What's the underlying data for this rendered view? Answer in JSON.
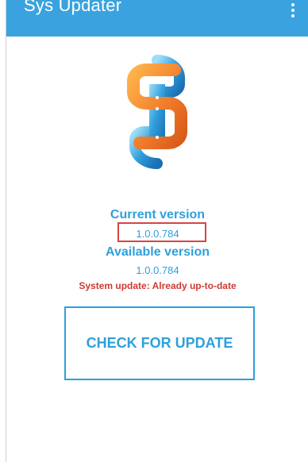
{
  "appbar": {
    "title": "Sys Updater",
    "color": "#3aa3df",
    "menu_icon": "more-vert-icon"
  },
  "logo": {
    "icon": "sys-updater-logo",
    "colors": {
      "orange": "#f07a2a",
      "blue": "#2f9fdc"
    }
  },
  "current": {
    "label": "Current version",
    "value": "1.0.0.784"
  },
  "available": {
    "label": "Available version",
    "value": "1.0.0.784"
  },
  "status": {
    "text": "System update: Already up-to-date",
    "color": "#d03a34"
  },
  "check_button": {
    "label": "CHECK FOR UPDATE"
  },
  "highlight_color": "#d64545"
}
